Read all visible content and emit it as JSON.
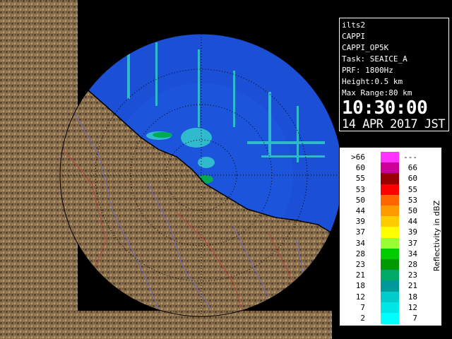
{
  "info": {
    "site": "ilts2",
    "product": "CAPPI",
    "product_name": "CAPPI_OP5K",
    "task": "Task: SEAICE_A",
    "prf": "PRF: 1800Hz",
    "height": "Height:0.5 km",
    "max_range": "Max Range:80 km",
    "time": "10:30:00",
    "date": "14 APR 2017 JST"
  },
  "legend": {
    "title": "Reflectivity in dBZ",
    "rows": [
      {
        "lo": ">66",
        "hi": "---",
        "color": "#ff33ff"
      },
      {
        "lo": "60",
        "hi": "66",
        "color": "#cc0099"
      },
      {
        "lo": "55",
        "hi": "60",
        "color": "#990000"
      },
      {
        "lo": "53",
        "hi": "55",
        "color": "#ff0000"
      },
      {
        "lo": "50",
        "hi": "53",
        "color": "#ff6600"
      },
      {
        "lo": "44",
        "hi": "50",
        "color": "#ff9900"
      },
      {
        "lo": "39",
        "hi": "44",
        "color": "#ffcc00"
      },
      {
        "lo": "37",
        "hi": "39",
        "color": "#ffff00"
      },
      {
        "lo": "34",
        "hi": "37",
        "color": "#99ff33"
      },
      {
        "lo": "28",
        "hi": "34",
        "color": "#00cc00"
      },
      {
        "lo": "23",
        "hi": "28",
        "color": "#009900"
      },
      {
        "lo": "21",
        "hi": "23",
        "color": "#00aa66"
      },
      {
        "lo": "18",
        "hi": "21",
        "color": "#009999"
      },
      {
        "lo": "12",
        "hi": "18",
        "color": "#00cccc"
      },
      {
        "lo": "7",
        "hi": "12",
        "color": "#00e6e6"
      },
      {
        "lo": "2",
        "hi": "7",
        "color": "#00ffff"
      }
    ]
  },
  "colors": {
    "sea": "#1a4fd6",
    "land": "#8a6e4a",
    "echo_light": "#33cccc",
    "echo_strong": "#00aa55",
    "outside": "#000000"
  }
}
